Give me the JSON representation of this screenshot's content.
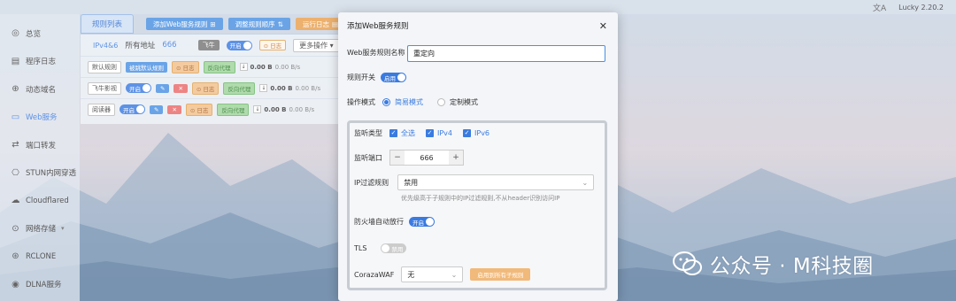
{
  "topbar": {
    "translate_icon": "translate-icon",
    "version": "Lucky 2.20.2"
  },
  "sidebar": {
    "items": [
      {
        "label": "总览",
        "icon": "dashboard-icon",
        "active": false
      },
      {
        "label": "程序日志",
        "icon": "log-icon",
        "active": false
      },
      {
        "label": "动态域名",
        "icon": "ddns-icon",
        "active": false
      },
      {
        "label": "Web服务",
        "icon": "web-icon",
        "active": true
      },
      {
        "label": "端口转发",
        "icon": "port-forward-icon",
        "active": false
      },
      {
        "label": "STUN内网穿透",
        "icon": "stun-icon",
        "active": false
      },
      {
        "label": "Cloudflared",
        "icon": "cloud-icon",
        "active": false
      },
      {
        "label": "网络存储",
        "icon": "storage-icon",
        "active": false
      },
      {
        "label": "RCLONE",
        "icon": "rclone-icon",
        "active": false
      },
      {
        "label": "DLNA服务",
        "icon": "dlna-icon",
        "active": false
      }
    ]
  },
  "main": {
    "tab_active": "规则列表",
    "btn_add": "添加Web服务规则",
    "btn_sort": "调整规则顺序",
    "btn_logs": "运行日志",
    "listen": {
      "ip_type": "IPv4&6",
      "addr_label": "所有地址",
      "port": "666",
      "chip_fly": "飞牛",
      "toggle": "开启",
      "log": "日志",
      "more": "更多操作"
    },
    "rules": [
      {
        "name": "默认规则",
        "status": "被跳默认规则",
        "log": "日志",
        "mode": "反向代理",
        "traffic": "0.00 B",
        "rate": "0.00 B/s"
      },
      {
        "name": "飞牛影视",
        "status": "开启",
        "log": "日志",
        "mode": "反向代理",
        "traffic": "0.00 B",
        "rate": "0.00 B/s"
      },
      {
        "name": "阅读器",
        "status": "开启",
        "log": "日志",
        "mode": "反向代理",
        "traffic": "0.00 B",
        "rate": "0.00 B/s"
      }
    ]
  },
  "modal": {
    "title": "添加Web服务规则",
    "name_label": "Web服务规则名称",
    "name_value": "重定向",
    "switch_label": "规则开关",
    "switch_state": "启用",
    "mode_label": "操作模式",
    "mode_simple": "简易模式",
    "mode_custom": "定制模式",
    "listen_type_label": "监听类型",
    "listen_all": "全选",
    "listen_ipv4": "IPv4",
    "listen_ipv6": "IPv6",
    "port_label": "监听端口",
    "port_value": "666",
    "ipfilter_label": "IP过滤规则",
    "ipfilter_value": "禁用",
    "ipfilter_hint": "优先级高于子规则中的IP过滤规则,不从header识别访问IP",
    "firewall_label": "防火墙自动放行",
    "firewall_state": "开启",
    "tls_label": "TLS",
    "tls_state": "禁用",
    "waf_label": "CorazaWAF",
    "waf_value": "无",
    "waf_button": "启用到所有子规则"
  },
  "watermark": {
    "text": "公众号 · M科技圈"
  },
  "colors": {
    "accent": "#3a7be0",
    "orange": "#e8a050",
    "green": "#6cb86a",
    "red": "#e96a6a"
  }
}
